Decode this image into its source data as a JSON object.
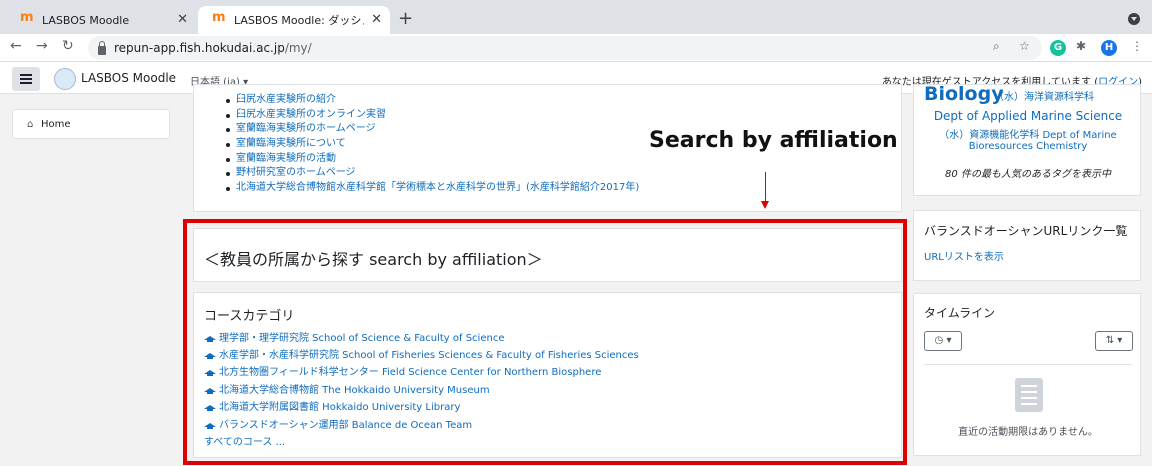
{
  "browser": {
    "tabs": [
      {
        "title": "LASBOS Moodle"
      },
      {
        "title": "LASBOS Moodle: ダッシュボード"
      }
    ],
    "url_host": "repun-app.fish.hokudai.ac.jp",
    "url_path": "/my/",
    "profile_initial": "H",
    "ext_initial": "G"
  },
  "navbar": {
    "site_name": "LASBOS Moodle",
    "language": "日本語 (ja)",
    "guest_text": "あなたは現在ゲストアクセスを利用しています (",
    "login_label": "ログイン",
    "guest_close": ")"
  },
  "drawer": {
    "home_label": "Home"
  },
  "links": [
    "臼尻水産実験所の紹介",
    "臼尻水産実験所のオンライン実習",
    "室蘭臨海実験所のホームページ",
    "室蘭臨海実験所について",
    "室蘭臨海実験所の活動",
    "野村研究室のホームページ",
    "北海道大学総合博物館水産科学館「学術標本と水産科学の世界」(水産科学館紹介2017年)"
  ],
  "annotation": "Search by affiliation",
  "affiliation": {
    "title": "＜教員の所属から探す search by affiliation＞"
  },
  "categories": {
    "heading": "コースカテゴリ",
    "items": [
      "理学部・理学研究院 School of Science & Faculty of Science",
      "水産学部・水産科学研究院 School of Fisheries Sciences & Faculty of Fisheries Sciences",
      "北方生物圏フィールド科学センター Field Science Center for Northern Biosphere",
      "北海道大学総合博物館 The Hokkaido University Museum",
      "北海道大学附属図書館 Hokkaido University Library",
      "バランスドオーシャン運用部 Balance de Ocean Team"
    ],
    "all_courses": "すべてのコース ..."
  },
  "tags": {
    "partial_big": "Biology",
    "partial_small": "（水）海洋資源科学科",
    "tag1": "Dept of Applied Marine Science",
    "tag2": "（水）資源機能化学科 Dept of Marine",
    "tag3": "Bioresources Chemistry",
    "popular": "80 件の最も人気のあるタグを表示中"
  },
  "balanced": {
    "title": "バランスドオーシャンURLリンク一覧",
    "link": "URLリストを表示"
  },
  "timeline": {
    "title": "タイムライン",
    "empty": "直近の活動期限はありません。"
  }
}
